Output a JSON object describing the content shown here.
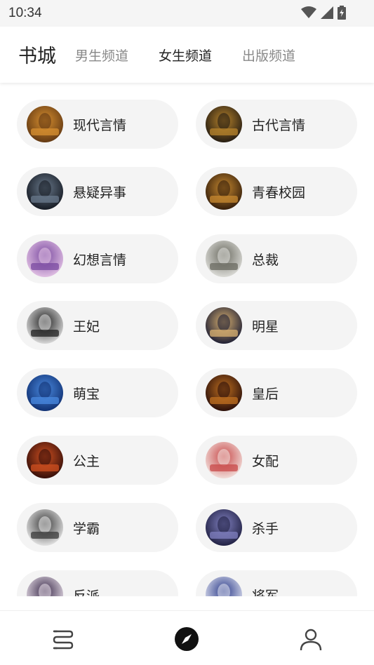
{
  "status_bar": {
    "time": "10:34",
    "icons": [
      "wifi-icon",
      "signal-icon",
      "battery-charging-icon"
    ]
  },
  "header": {
    "title": "书城",
    "tabs": [
      {
        "label": "男生频道",
        "active": false
      },
      {
        "label": "女生频道",
        "active": true
      },
      {
        "label": "出版频道",
        "active": false
      }
    ]
  },
  "categories": [
    {
      "label": "现代言情",
      "cover": [
        "#5a3210",
        "#d89030"
      ]
    },
    {
      "label": "古代言情",
      "cover": [
        "#1a1410",
        "#b8842c"
      ]
    },
    {
      "label": "悬疑异事",
      "cover": [
        "#10141c",
        "#6a7a8c"
      ]
    },
    {
      "label": "青春校园",
      "cover": [
        "#2a1608",
        "#c88a30"
      ]
    },
    {
      "label": "幻想言情",
      "cover": [
        "#e8c8e8",
        "#7a4aa0"
      ]
    },
    {
      "label": "总裁",
      "cover": [
        "#e4e4e0",
        "#6a6a60"
      ]
    },
    {
      "label": "王妃",
      "cover": [
        "#e8e8e8",
        "#202020"
      ]
    },
    {
      "label": "明星",
      "cover": [
        "#101430",
        "#d8b070"
      ]
    },
    {
      "label": "萌宝",
      "cover": [
        "#0c2a6a",
        "#4a8ae0"
      ]
    },
    {
      "label": "皇后",
      "cover": [
        "#200808",
        "#c07020"
      ]
    },
    {
      "label": "公主",
      "cover": [
        "#2a0a08",
        "#d05020"
      ]
    },
    {
      "label": "女配",
      "cover": [
        "#f4e8e4",
        "#c84848"
      ]
    },
    {
      "label": "学霸",
      "cover": [
        "#f0f0f0",
        "#3a3a3a"
      ]
    },
    {
      "label": "杀手",
      "cover": [
        "#1a1a3a",
        "#8080c0"
      ]
    },
    {
      "label": "反派",
      "cover": [
        "#f0e8f0",
        "#3a2a4a"
      ]
    },
    {
      "label": "将军",
      "cover": [
        "#e8eaf4",
        "#2a3a8a"
      ]
    }
  ],
  "bottom_nav": [
    {
      "name": "bookshelf-icon",
      "active": false
    },
    {
      "name": "discover-icon",
      "active": true
    },
    {
      "name": "profile-icon",
      "active": false
    }
  ]
}
